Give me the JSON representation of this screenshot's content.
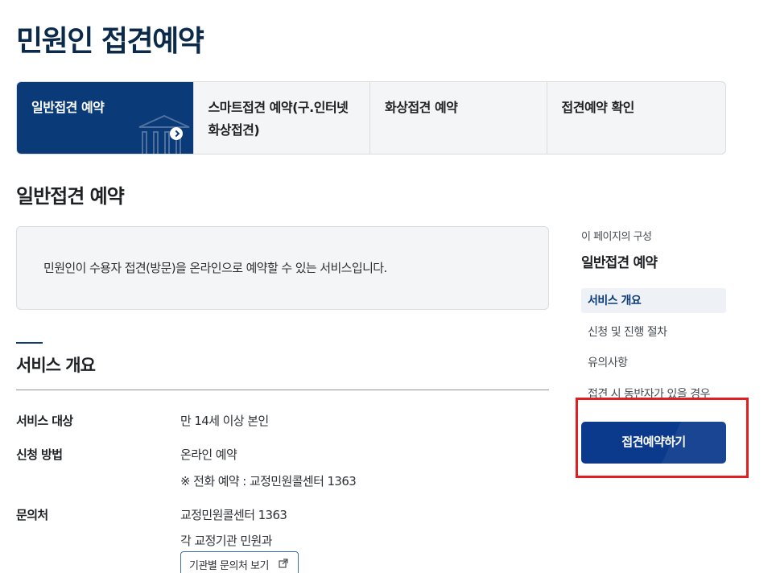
{
  "page_title": "민원인 접견예약",
  "tabs": [
    {
      "label": "일반접견 예약",
      "active": true
    },
    {
      "label": "스마트접견 예약(구.인터넷화상접견)",
      "active": false
    },
    {
      "label": "화상접견 예약",
      "active": false
    },
    {
      "label": "접견예약 확인",
      "active": false
    }
  ],
  "section_title": "일반접견 예약",
  "intro_text": "민원인이 수용자 접견(방문)을 온라인으로 예약할 수 있는 서비스입니다.",
  "overview": {
    "heading": "서비스 개요",
    "rows": [
      {
        "label": "서비스 대상",
        "values": [
          "만 14세 이상 본인"
        ]
      },
      {
        "label": "신청 방법",
        "values": [
          "온라인 예약",
          "※ 전화 예약 : 교정민원콜센터 1363"
        ]
      },
      {
        "label": "문의처",
        "values": [
          "교정민원콜센터 1363",
          "각 교정기관 민원과"
        ],
        "link_label": "기관별 문의처 보기"
      }
    ]
  },
  "toc": {
    "caption": "이 페이지의 구성",
    "title": "일반접견 예약",
    "items": [
      {
        "label": "서비스 개요",
        "active": true
      },
      {
        "label": "신청 및 진행 절차",
        "active": false
      },
      {
        "label": "유의사항",
        "active": false
      },
      {
        "label": "접견 시 동반자가 있을 경우",
        "active": false
      }
    ]
  },
  "reserve_button_label": "접견예약하기",
  "colors": {
    "primary": "#0b3a78",
    "button": "#0b3a8c",
    "highlight": "#e02020",
    "title": "#0b2a4a"
  }
}
